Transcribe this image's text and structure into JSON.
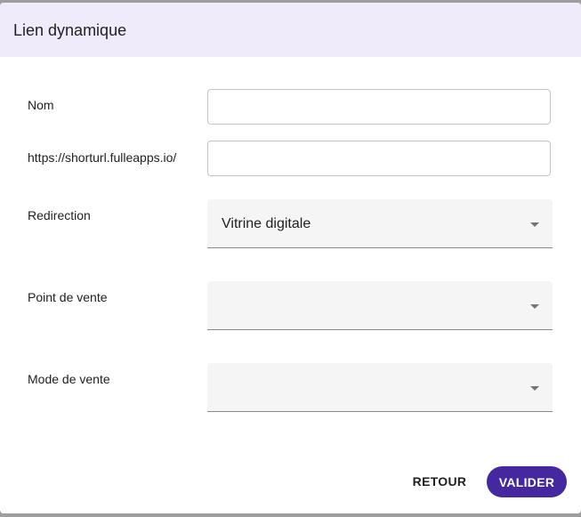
{
  "dialog": {
    "title": "Lien dynamique"
  },
  "form": {
    "nom": {
      "label": "Nom",
      "value": ""
    },
    "shorturl": {
      "label": "https://shorturl.fulleapps.io/",
      "value": ""
    },
    "redirection": {
      "label": "Redirection",
      "selected": "Vitrine digitale"
    },
    "point_de_vente": {
      "label": "Point de vente",
      "selected": ""
    },
    "mode_de_vente": {
      "label": "Mode de vente",
      "selected": ""
    }
  },
  "actions": {
    "back_label": "RETOUR",
    "submit_label": "VALIDER"
  },
  "colors": {
    "header_bg": "#efebfa",
    "primary": "#4527a0",
    "select_bg": "#f5f5f5"
  },
  "icons": {
    "dropdown": "caret-down-icon"
  }
}
